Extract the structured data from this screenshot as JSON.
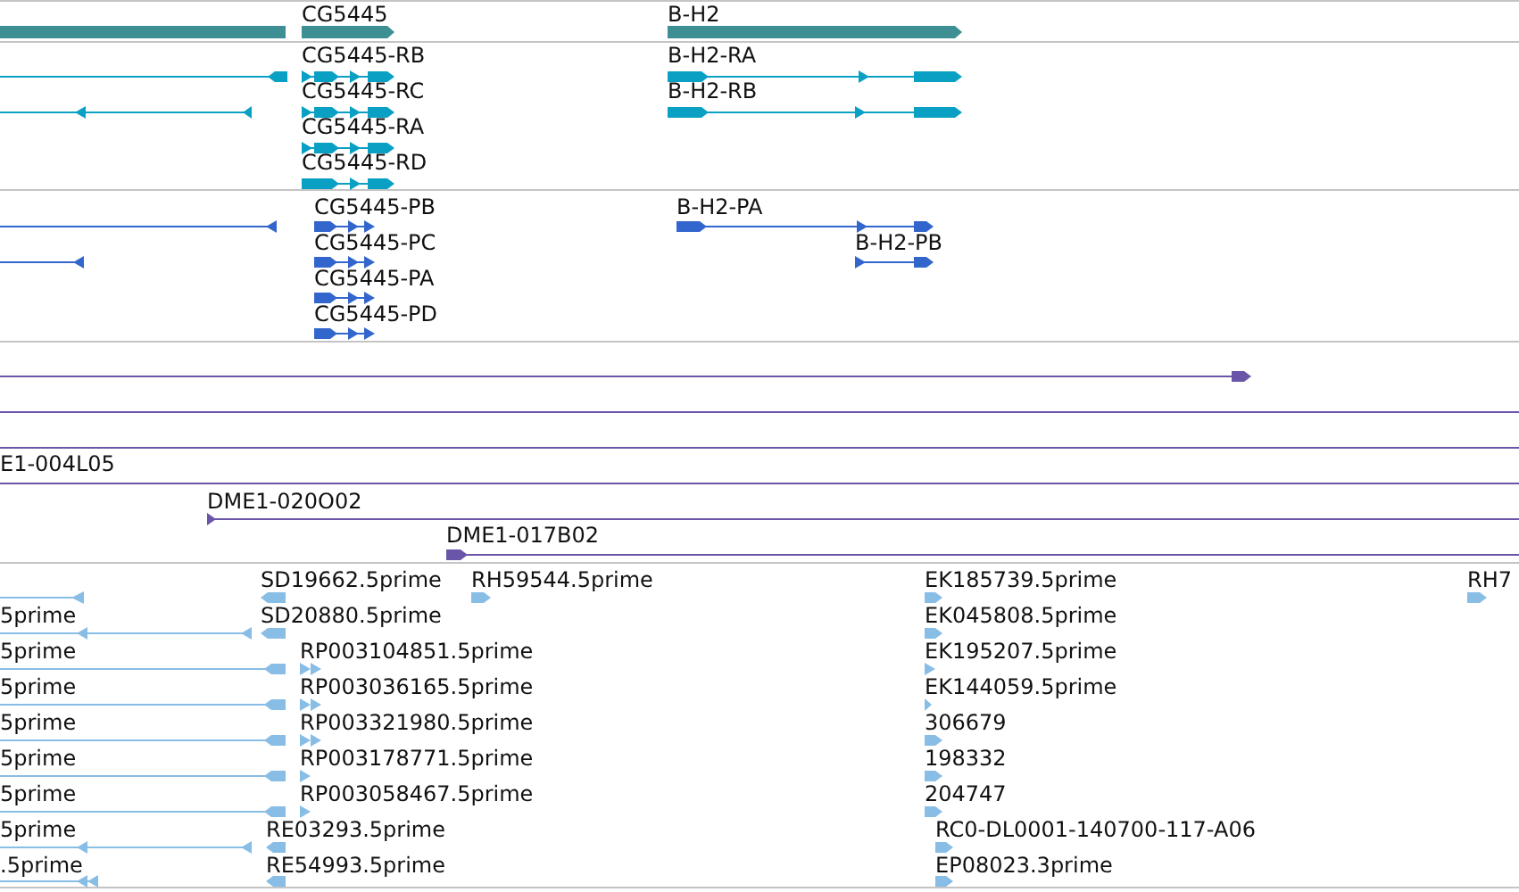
{
  "tracks": [
    {
      "kind": "gene",
      "features": [
        {
          "label": "CG5445"
        },
        {
          "label": "B-H2"
        }
      ]
    },
    {
      "kind": "transcript",
      "features": [
        {
          "label": "CG5445-RB"
        },
        {
          "label": "CG5445-RC"
        },
        {
          "label": "CG5445-RA"
        },
        {
          "label": "CG5445-RD"
        },
        {
          "label": "B-H2-RA"
        },
        {
          "label": "B-H2-RB"
        }
      ]
    },
    {
      "kind": "protein",
      "features": [
        {
          "label": "CG5445-PB"
        },
        {
          "label": "CG5445-PC"
        },
        {
          "label": "CG5445-PA"
        },
        {
          "label": "CG5445-PD"
        },
        {
          "label": "B-H2-PA"
        },
        {
          "label": "B-H2-PB"
        }
      ]
    },
    {
      "kind": "clone",
      "features": [
        {
          "label": "E1-004L05"
        },
        {
          "label": "DME1-020O02"
        },
        {
          "label": "DME1-017B02"
        }
      ]
    },
    {
      "kind": "est",
      "features": [
        {
          "label": "5prime"
        },
        {
          "label": "5prime"
        },
        {
          "label": "5prime"
        },
        {
          "label": "5prime"
        },
        {
          "label": "5prime"
        },
        {
          "label": "5prime"
        },
        {
          "label": "5prime"
        },
        {
          "label": ".5prime"
        },
        {
          "label": "SD19662.5prime"
        },
        {
          "label": "SD20880.5prime"
        },
        {
          "label": "RP003104851.5prime"
        },
        {
          "label": "RP003036165.5prime"
        },
        {
          "label": "RP003321980.5prime"
        },
        {
          "label": "RP003178771.5prime"
        },
        {
          "label": "RP003058467.5prime"
        },
        {
          "label": "RE03293.5prime"
        },
        {
          "label": "RE54993.5prime"
        },
        {
          "label": "RH59544.5prime"
        },
        {
          "label": "EK185739.5prime"
        },
        {
          "label": "EK045808.5prime"
        },
        {
          "label": "EK195207.5prime"
        },
        {
          "label": "EK144059.5prime"
        },
        {
          "label": "306679"
        },
        {
          "label": "198332"
        },
        {
          "label": "204747"
        },
        {
          "label": "RC0-DL0001-140700-117-A06"
        },
        {
          "label": "EP08023.3prime"
        },
        {
          "label": "RH7"
        }
      ]
    }
  ]
}
